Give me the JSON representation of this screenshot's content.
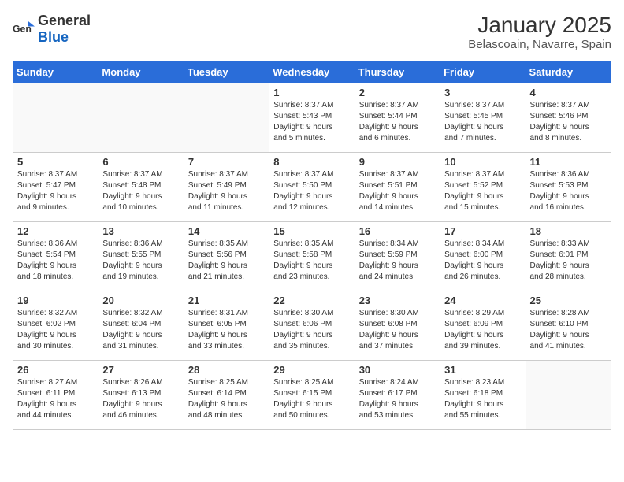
{
  "header": {
    "logo_general": "General",
    "logo_blue": "Blue",
    "title": "January 2025",
    "subtitle": "Belascoain, Navarre, Spain"
  },
  "weekdays": [
    "Sunday",
    "Monday",
    "Tuesday",
    "Wednesday",
    "Thursday",
    "Friday",
    "Saturday"
  ],
  "weeks": [
    [
      {
        "day": "",
        "info": ""
      },
      {
        "day": "",
        "info": ""
      },
      {
        "day": "",
        "info": ""
      },
      {
        "day": "1",
        "info": "Sunrise: 8:37 AM\nSunset: 5:43 PM\nDaylight: 9 hours\nand 5 minutes."
      },
      {
        "day": "2",
        "info": "Sunrise: 8:37 AM\nSunset: 5:44 PM\nDaylight: 9 hours\nand 6 minutes."
      },
      {
        "day": "3",
        "info": "Sunrise: 8:37 AM\nSunset: 5:45 PM\nDaylight: 9 hours\nand 7 minutes."
      },
      {
        "day": "4",
        "info": "Sunrise: 8:37 AM\nSunset: 5:46 PM\nDaylight: 9 hours\nand 8 minutes."
      }
    ],
    [
      {
        "day": "5",
        "info": "Sunrise: 8:37 AM\nSunset: 5:47 PM\nDaylight: 9 hours\nand 9 minutes."
      },
      {
        "day": "6",
        "info": "Sunrise: 8:37 AM\nSunset: 5:48 PM\nDaylight: 9 hours\nand 10 minutes."
      },
      {
        "day": "7",
        "info": "Sunrise: 8:37 AM\nSunset: 5:49 PM\nDaylight: 9 hours\nand 11 minutes."
      },
      {
        "day": "8",
        "info": "Sunrise: 8:37 AM\nSunset: 5:50 PM\nDaylight: 9 hours\nand 12 minutes."
      },
      {
        "day": "9",
        "info": "Sunrise: 8:37 AM\nSunset: 5:51 PM\nDaylight: 9 hours\nand 14 minutes."
      },
      {
        "day": "10",
        "info": "Sunrise: 8:37 AM\nSunset: 5:52 PM\nDaylight: 9 hours\nand 15 minutes."
      },
      {
        "day": "11",
        "info": "Sunrise: 8:36 AM\nSunset: 5:53 PM\nDaylight: 9 hours\nand 16 minutes."
      }
    ],
    [
      {
        "day": "12",
        "info": "Sunrise: 8:36 AM\nSunset: 5:54 PM\nDaylight: 9 hours\nand 18 minutes."
      },
      {
        "day": "13",
        "info": "Sunrise: 8:36 AM\nSunset: 5:55 PM\nDaylight: 9 hours\nand 19 minutes."
      },
      {
        "day": "14",
        "info": "Sunrise: 8:35 AM\nSunset: 5:56 PM\nDaylight: 9 hours\nand 21 minutes."
      },
      {
        "day": "15",
        "info": "Sunrise: 8:35 AM\nSunset: 5:58 PM\nDaylight: 9 hours\nand 23 minutes."
      },
      {
        "day": "16",
        "info": "Sunrise: 8:34 AM\nSunset: 5:59 PM\nDaylight: 9 hours\nand 24 minutes."
      },
      {
        "day": "17",
        "info": "Sunrise: 8:34 AM\nSunset: 6:00 PM\nDaylight: 9 hours\nand 26 minutes."
      },
      {
        "day": "18",
        "info": "Sunrise: 8:33 AM\nSunset: 6:01 PM\nDaylight: 9 hours\nand 28 minutes."
      }
    ],
    [
      {
        "day": "19",
        "info": "Sunrise: 8:32 AM\nSunset: 6:02 PM\nDaylight: 9 hours\nand 30 minutes."
      },
      {
        "day": "20",
        "info": "Sunrise: 8:32 AM\nSunset: 6:04 PM\nDaylight: 9 hours\nand 31 minutes."
      },
      {
        "day": "21",
        "info": "Sunrise: 8:31 AM\nSunset: 6:05 PM\nDaylight: 9 hours\nand 33 minutes."
      },
      {
        "day": "22",
        "info": "Sunrise: 8:30 AM\nSunset: 6:06 PM\nDaylight: 9 hours\nand 35 minutes."
      },
      {
        "day": "23",
        "info": "Sunrise: 8:30 AM\nSunset: 6:08 PM\nDaylight: 9 hours\nand 37 minutes."
      },
      {
        "day": "24",
        "info": "Sunrise: 8:29 AM\nSunset: 6:09 PM\nDaylight: 9 hours\nand 39 minutes."
      },
      {
        "day": "25",
        "info": "Sunrise: 8:28 AM\nSunset: 6:10 PM\nDaylight: 9 hours\nand 41 minutes."
      }
    ],
    [
      {
        "day": "26",
        "info": "Sunrise: 8:27 AM\nSunset: 6:11 PM\nDaylight: 9 hours\nand 44 minutes."
      },
      {
        "day": "27",
        "info": "Sunrise: 8:26 AM\nSunset: 6:13 PM\nDaylight: 9 hours\nand 46 minutes."
      },
      {
        "day": "28",
        "info": "Sunrise: 8:25 AM\nSunset: 6:14 PM\nDaylight: 9 hours\nand 48 minutes."
      },
      {
        "day": "29",
        "info": "Sunrise: 8:25 AM\nSunset: 6:15 PM\nDaylight: 9 hours\nand 50 minutes."
      },
      {
        "day": "30",
        "info": "Sunrise: 8:24 AM\nSunset: 6:17 PM\nDaylight: 9 hours\nand 53 minutes."
      },
      {
        "day": "31",
        "info": "Sunrise: 8:23 AM\nSunset: 6:18 PM\nDaylight: 9 hours\nand 55 minutes."
      },
      {
        "day": "",
        "info": ""
      }
    ]
  ]
}
